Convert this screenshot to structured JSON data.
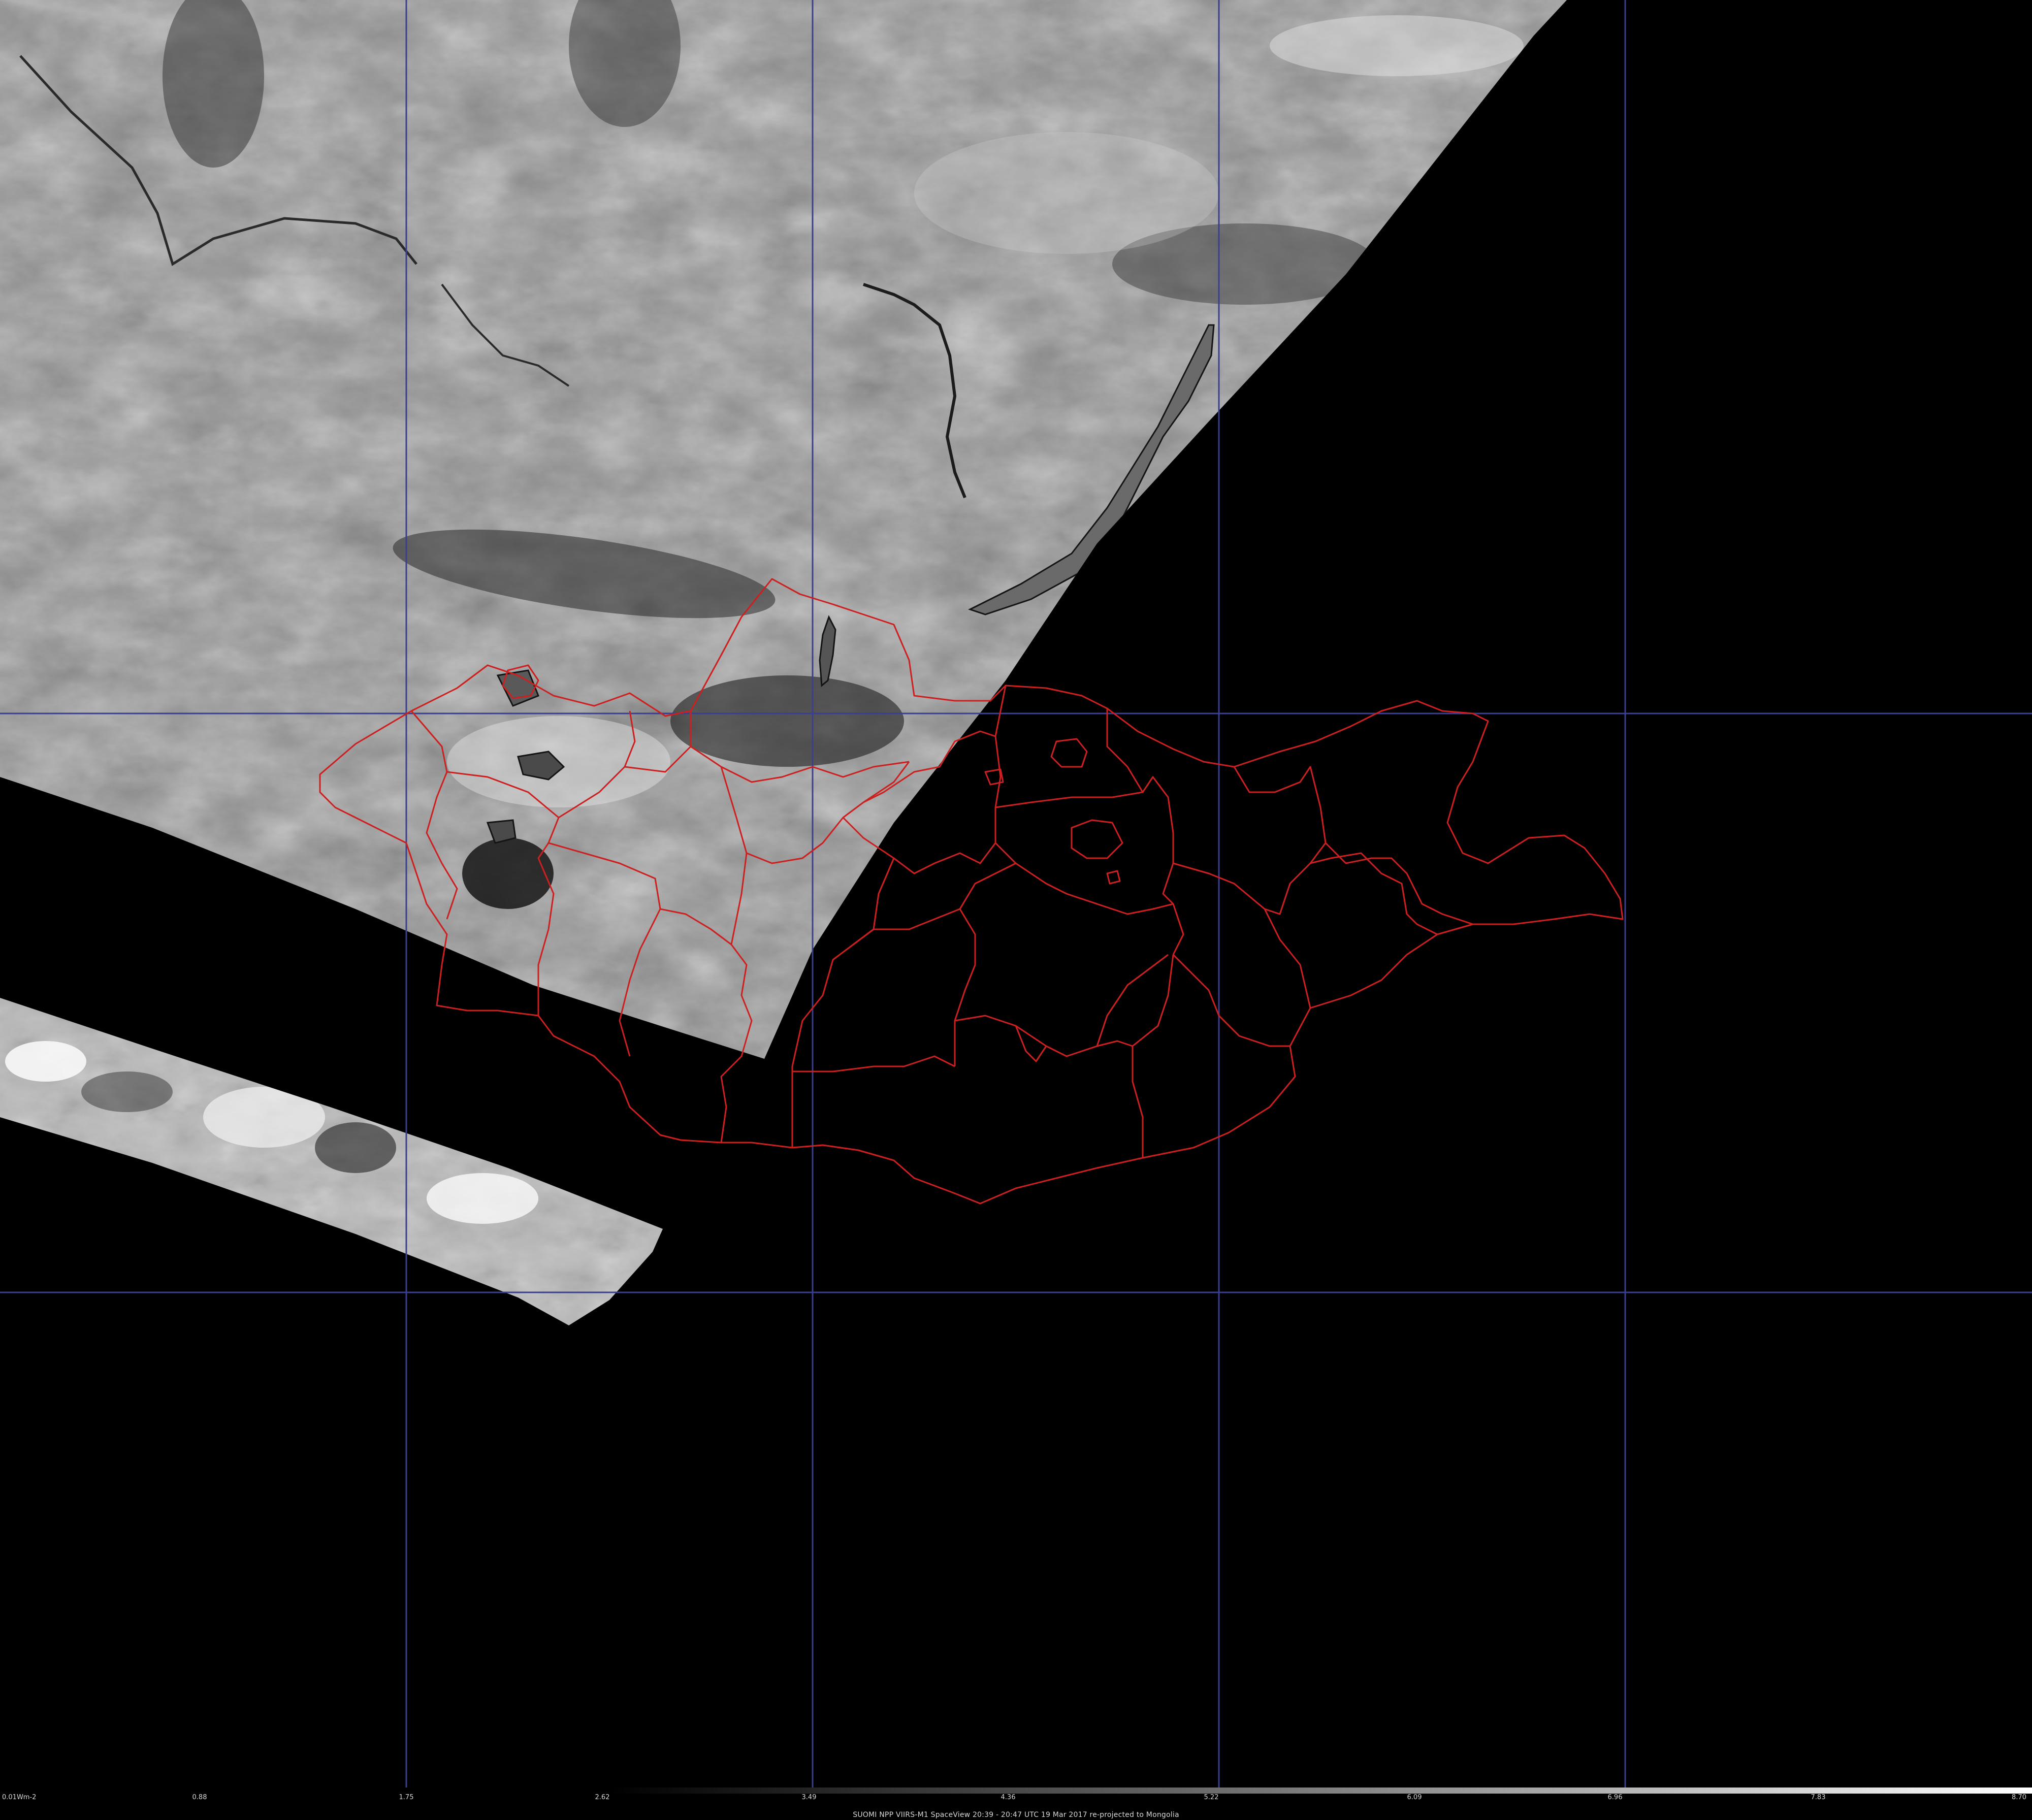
{
  "map": {
    "background_color": "#000000",
    "grid_color": "#3a3f8f",
    "border_color": "#cc2020",
    "lake_outline_color": "#141414"
  },
  "legend": {
    "ticks": [
      "0.01Wm-2",
      "0.88",
      "1.75",
      "2.62",
      "3.49",
      "4.36",
      "5.22",
      "6.09",
      "6.96",
      "7.83",
      "8.70"
    ],
    "colormap": [
      "#000000",
      "#ffffff"
    ]
  },
  "caption": "SUOMI NPP VIIRS-M1 SpaceView 20:39 - 20:47 UTC 19 Mar 2017 re-projected to Mongolia"
}
